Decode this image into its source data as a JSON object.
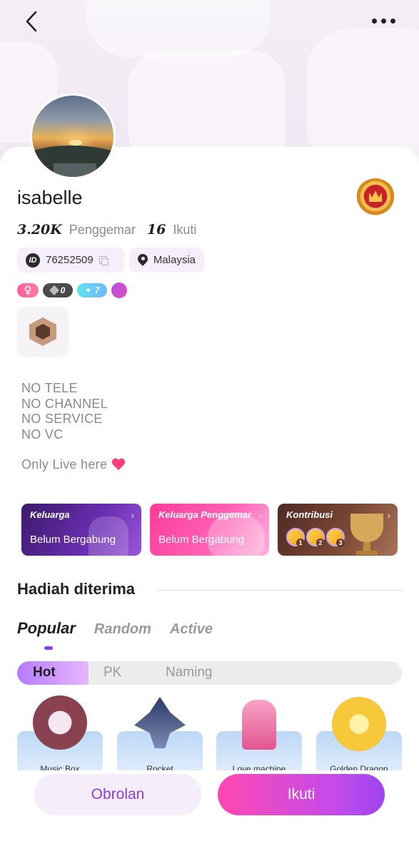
{
  "nav": {
    "back_icon": "chevron-left-icon",
    "more_icon": "more-horizontal-icon"
  },
  "profile": {
    "name": "isabelle",
    "followers_count": "3.20K",
    "followers_label": "Penggemar",
    "following_count": "16",
    "following_label": "Ikuti",
    "id_badge": "ID",
    "user_id": "76252509",
    "location": "Malaysia",
    "tags": {
      "level_value": "0",
      "star_value": "7"
    },
    "bio_lines": [
      "NO TELE",
      "NO CHANNEL",
      "NO SERVICE",
      "NO VC"
    ],
    "bio_extra": "Only Live here"
  },
  "family_cards": [
    {
      "title": "Keluarga",
      "subtitle": "Belum Bergabung"
    },
    {
      "title": "Keluarga Penggemar",
      "subtitle": "Belum Bergabung"
    },
    {
      "title": "Kontribusi",
      "ranks": [
        "1",
        "2",
        "3"
      ]
    }
  ],
  "gifts": {
    "section_title": "Hadiah diterima",
    "tabs": [
      "Popular",
      "Random",
      "Active"
    ],
    "active_tab": "Popular",
    "segments": [
      "Hot",
      "PK",
      "Naming"
    ],
    "active_segment": "Hot",
    "items": [
      "Music Box",
      "Rocket",
      "Love machine",
      "Golden Dragon"
    ]
  },
  "actions": {
    "chat_label": "Obrolan",
    "follow_label": "Ikuti"
  },
  "colors": {
    "accent_purple": "#8b3cf0",
    "follow_gradient_start": "#ff48b0",
    "follow_gradient_end": "#9f45f0"
  }
}
